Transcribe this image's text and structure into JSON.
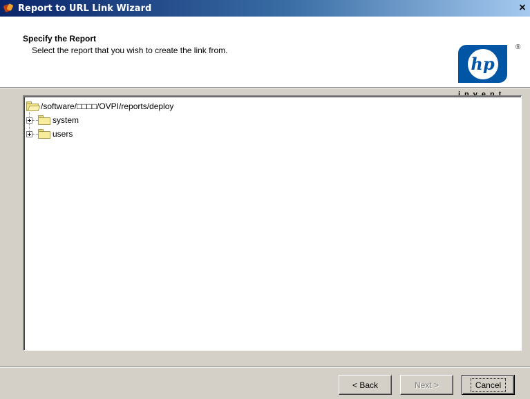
{
  "window": {
    "title": "Report to URL Link Wizard",
    "close_label": "×"
  },
  "header": {
    "title": "Specify the Report",
    "subtitle": "Select the report that you wish to create the link from."
  },
  "logo": {
    "mark": "hp",
    "registered": "®",
    "tagline": "invent",
    "brand_color": "#0055a5"
  },
  "tree": {
    "root": {
      "label": "/software/□□□□/OVPI/reports/deploy",
      "icon": "open-folder-icon"
    },
    "children": [
      {
        "label": "system",
        "icon": "folder-icon",
        "expanded": false
      },
      {
        "label": "users",
        "icon": "folder-icon",
        "expanded": false
      }
    ]
  },
  "buttons": {
    "back": "< Back",
    "next": "Next >",
    "cancel": "Cancel"
  },
  "colors": {
    "titlebar_start": "#0a246a",
    "titlebar_end": "#a6caf0",
    "dialog_bg": "#d4d0c8"
  }
}
